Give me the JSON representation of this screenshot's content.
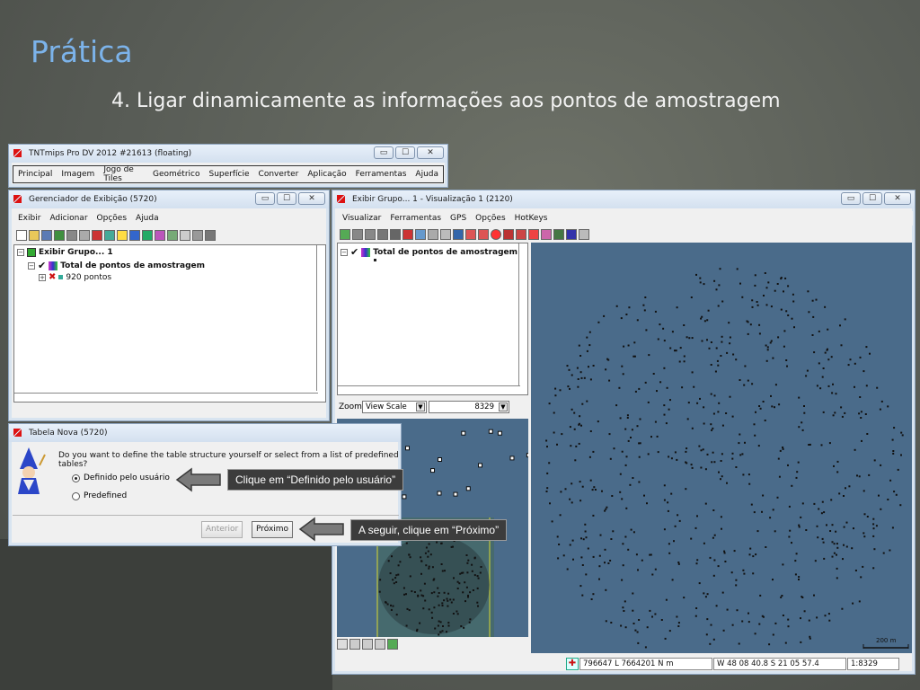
{
  "slide": {
    "title": "Prática",
    "subtitle": "4. Ligar dinamicamente as informações aos pontos de amostragem"
  },
  "main_window": {
    "title": "TNTmips Pro DV 2012  #21613 (floating)",
    "menu": [
      "Principal",
      "Imagem",
      "Jogo de Tiles",
      "Geométrico",
      "Superfície",
      "Converter",
      "Aplicação",
      "Ferramentas",
      "Ajuda"
    ]
  },
  "display_manager": {
    "title": "Gerenciador de Exibição (5720)",
    "menu": [
      "Exibir",
      "Adicionar",
      "Opções",
      "Ajuda"
    ],
    "tree": {
      "group": "Exibir Grupo... 1",
      "layer": "Total de pontos de amostragem",
      "points": "920 pontos"
    }
  },
  "view_window": {
    "title": "Exibir Grupo... 1 - Visualização 1 (2120)",
    "menu": [
      "Visualizar",
      "Ferramentas",
      "GPS",
      "Opções",
      "HotKeys"
    ],
    "legend_layer": "Total de pontos de amostragem",
    "zoom_label": "Zoom",
    "zoom_mode": "View Scale",
    "zoom_value": "8329",
    "scale_bar": "200 m",
    "status": {
      "coords": "796647 L  7664201 N m",
      "latlon": "W 48 08 40.8  S 21 05 57.4",
      "scale": "1:8329"
    }
  },
  "table_dialog": {
    "title": "Tabela Nova (5720)",
    "question": "Do you want to define the table structure yourself or select from a list of predefined tables?",
    "options": [
      "Definido pelo usuário",
      "Predefined"
    ],
    "selected_option": 0,
    "back_button": "Anterior",
    "next_button": "Próximo"
  },
  "callouts": {
    "first": "Clique em “Definido pelo usuário”",
    "second": "A seguir, clique em “Próximo”"
  },
  "colors": {
    "title_blue": "#7cb3ea",
    "map_background": "#4a6b8a",
    "callout_bg": "#3c3c3c"
  }
}
